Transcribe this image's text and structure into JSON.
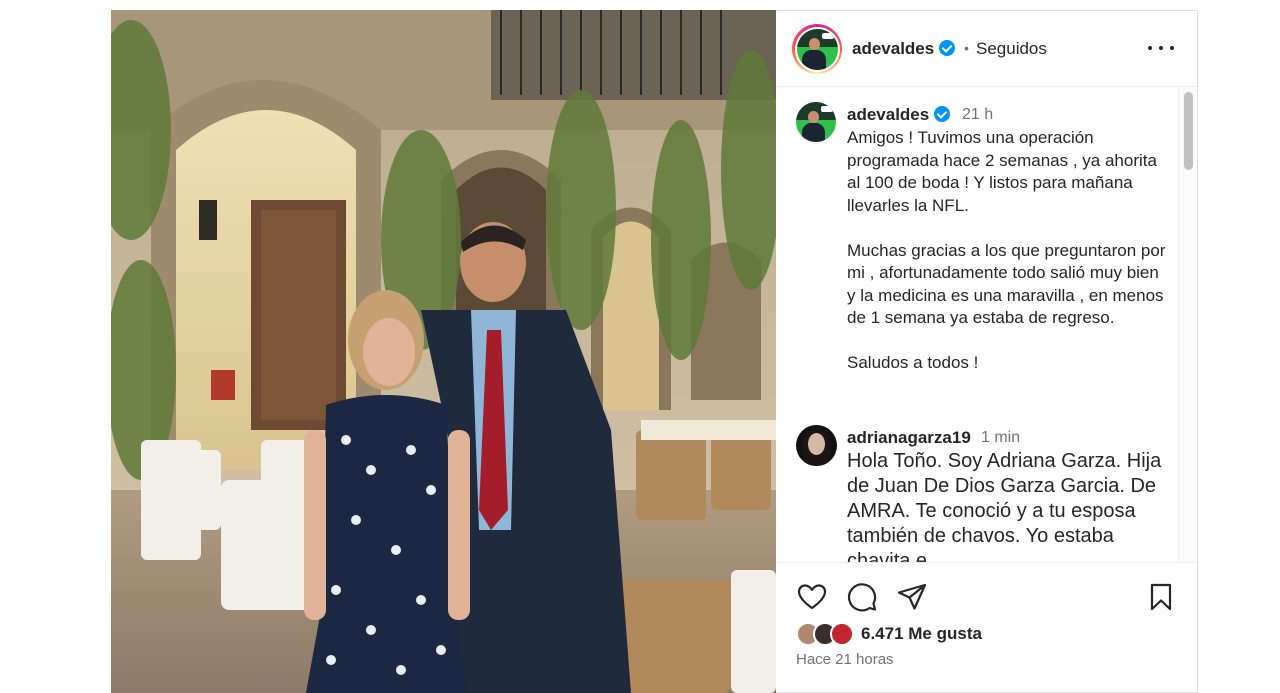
{
  "post": {
    "username": "adevaldes",
    "follow_status": "Seguidos",
    "separator": "•",
    "more_icon": "more-horizontal-icon"
  },
  "caption": {
    "username": "adevaldes",
    "time": "21 h",
    "text": "Amigos ! Tuvimos una operación programada hace 2 semanas , ya ahorita al 100 de boda ! Y listos para mañana llevarles la NFL.\n\nMuchas gracias a los que preguntaron por mi , afortunadamente todo salió muy bien y la medicina es una maravilla , en menos de 1 semana ya estaba de regreso.\n\nSaludos a todos !"
  },
  "reply": {
    "username": "adrianagarza19",
    "time": "1 min",
    "text": "Hola Toño. Soy Adriana Garza. Hija de Juan De Dios Garza Garcia. De AMRA. Te conoció y a tu esposa también de chavos. Yo estaba chavita e"
  },
  "actions": {
    "like_icon": "heart-icon",
    "comment_icon": "comment-icon",
    "share_icon": "send-icon",
    "save_icon": "bookmark-icon"
  },
  "likes": {
    "count_text": "6.471 Me gusta"
  },
  "time_ago": "Hace 21 horas",
  "colors": {
    "verified": "#0095f6",
    "text": "#262626",
    "muted": "#737373",
    "border": "#dbdbdb"
  }
}
